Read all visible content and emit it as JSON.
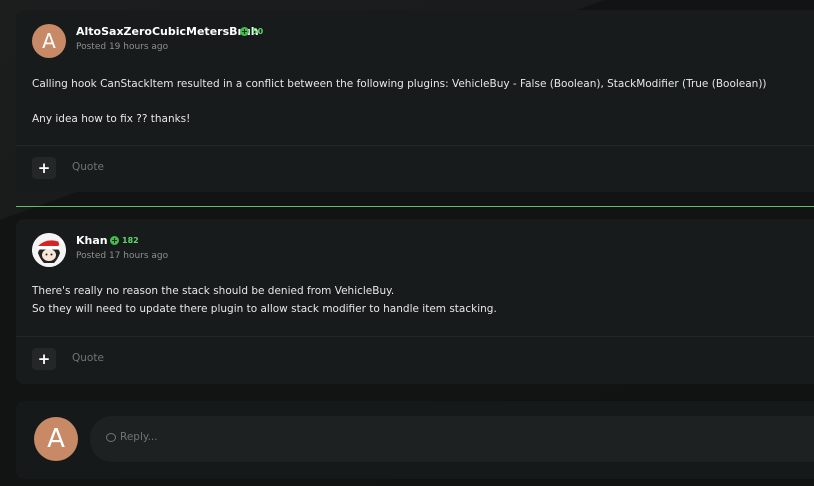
{
  "posts": [
    {
      "author": "AltoSaxZeroCubicMetersBruh",
      "avatar_letter": "A",
      "reputation": "50",
      "posted": "Posted 19 hours ago",
      "lines": [
        "Calling hook CanStackItem resulted in a conflict between the following plugins: VehicleBuy - False (Boolean), StackModifier (True (Boolean))",
        "Any idea how to fix ?? thanks!"
      ],
      "plus_label": "+",
      "quote_label": "Quote"
    },
    {
      "author": "Khan",
      "reputation": "182",
      "posted": "Posted 17 hours ago",
      "lines": [
        "There's really no reason the stack should be denied from VehicleBuy.",
        "So they will need to update there plugin to allow stack modifier to handle item stacking."
      ],
      "plus_label": "+",
      "quote_label": "Quote"
    }
  ],
  "reply": {
    "avatar_letter": "A",
    "placeholder": "Reply..."
  },
  "colors": {
    "accent_green": "#5fbf6a",
    "avatar_bg": "#c88a66"
  },
  "icons": {
    "reputation": "plus-circle-icon",
    "reply": "speech-bubble-icon"
  }
}
